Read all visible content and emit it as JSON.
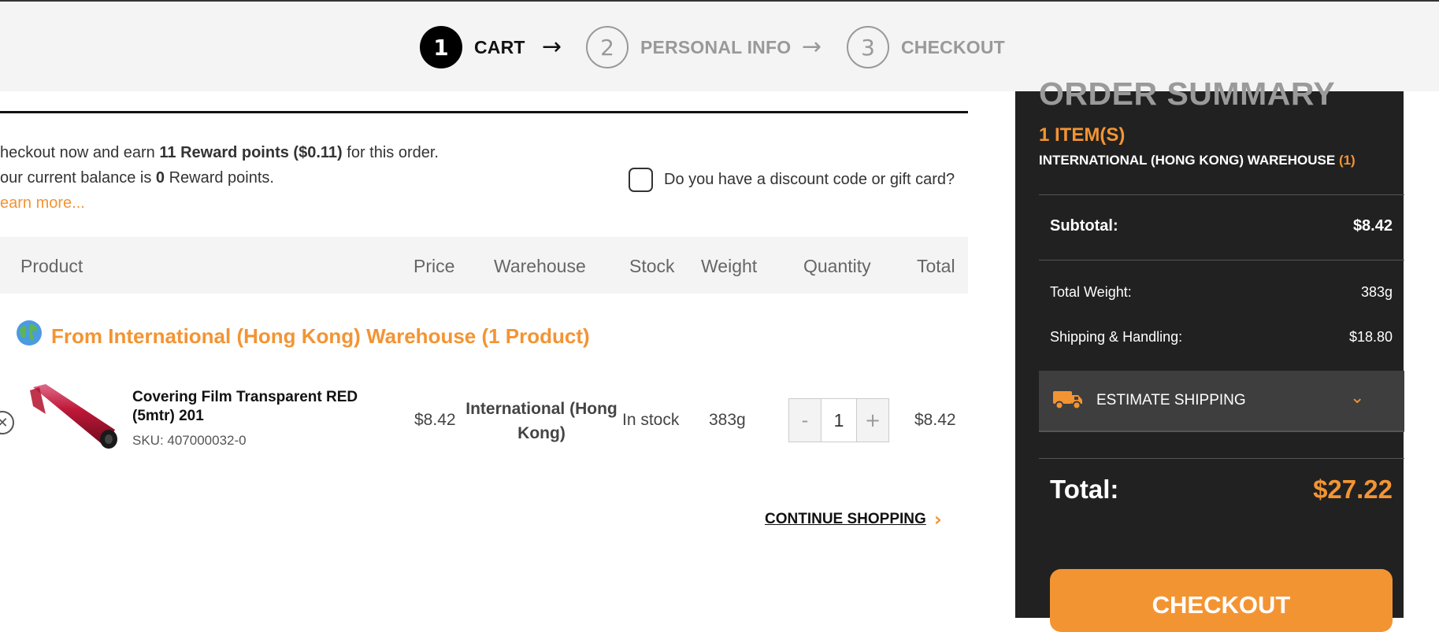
{
  "steps": [
    {
      "num": "1",
      "label": "CART"
    },
    {
      "num": "2",
      "label": "PERSONAL INFO"
    },
    {
      "num": "3",
      "label": "CHECKOUT"
    }
  ],
  "step_arrow": "→",
  "reward": {
    "line1_prefix": "heckout now and earn ",
    "line1_bold": "11 Reward points ($0.11)",
    "line1_suffix": " for this order.",
    "line2_prefix": "our current balance is ",
    "line2_bold": "0",
    "line2_suffix": " Reward points.",
    "learn_more": "earn more..."
  },
  "discount_label": "Do you have a discount code or gift card?",
  "table_headers": [
    "Product",
    "Price",
    "Warehouse",
    "Stock",
    "Weight",
    "Quantity",
    "Total"
  ],
  "group": {
    "icon": "globe-icon",
    "title": "From International (Hong Kong) Warehouse (1 Product)"
  },
  "product": {
    "name": "Covering Film Transparent RED (5mtr) 201",
    "sku": "SKU: 407000032-0",
    "price": "$8.42",
    "warehouse": "International (Hong Kong)",
    "stock": "In stock",
    "weight": "383g",
    "quantity": "1",
    "minus": "-",
    "plus": "+",
    "total": "$8.42"
  },
  "continue_shopping": "CONTINUE SHOPPING",
  "summary": {
    "title": "ORDER SUMMARY",
    "items": "1 ITEM(S)",
    "warehouse_line": "INTERNATIONAL (HONG KONG) WAREHOUSE",
    "warehouse_count": "(1)",
    "subtotal_label": "Subtotal:",
    "subtotal_value": "$8.42",
    "weight_label": "Total Weight:",
    "weight_value": "383g",
    "shipping_label": "Shipping & Handling:",
    "shipping_value": "$18.80",
    "estimate_label": "ESTIMATE SHIPPING",
    "total_label": "Total:",
    "total_value": "$27.22",
    "checkout_label": "CHECKOUT"
  },
  "colors": {
    "accent": "#f39433",
    "panel": "#212121",
    "active_step": "#000000"
  }
}
